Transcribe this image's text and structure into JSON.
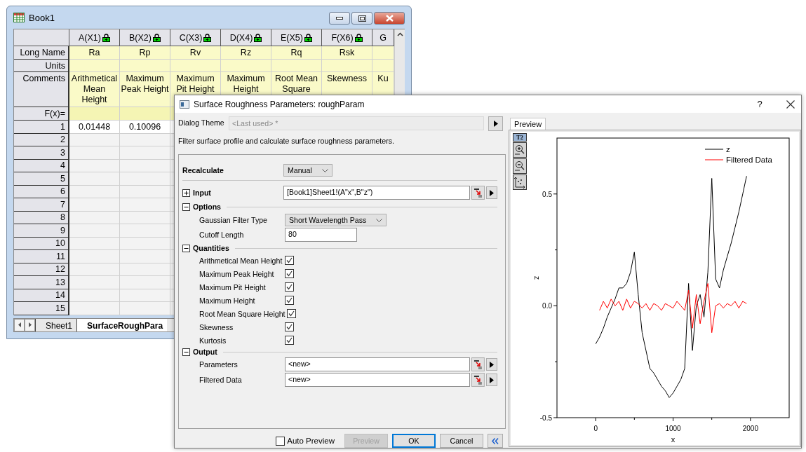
{
  "book": {
    "title": "Book1",
    "row_labels": [
      "Long Name",
      "Units",
      "Comments",
      "F(x)="
    ],
    "columns": [
      {
        "label": "A(X1)",
        "locked": true,
        "long_name": "Ra",
        "comments": "Arithmetical Mean Height"
      },
      {
        "label": "B(X2)",
        "locked": true,
        "long_name": "Rp",
        "comments": "Maximum Peak Height"
      },
      {
        "label": "C(X3)",
        "locked": true,
        "long_name": "Rv",
        "comments": "Maximum Pit Height"
      },
      {
        "label": "D(X4)",
        "locked": true,
        "long_name": "Rz",
        "comments": "Maximum Height"
      },
      {
        "label": "E(X5)",
        "locked": true,
        "long_name": "Rq",
        "comments": "Root Mean Square"
      },
      {
        "label": "F(X6)",
        "locked": true,
        "long_name": "Rsk",
        "comments": "Skewness"
      },
      {
        "label": "G",
        "locked": false,
        "comments": "Ku"
      }
    ],
    "rows": [
      {
        "label": "1",
        "cells": [
          "0.01448",
          "0.10096"
        ]
      },
      {
        "label": "2"
      },
      {
        "label": "3"
      },
      {
        "label": "4"
      },
      {
        "label": "5"
      },
      {
        "label": "6"
      },
      {
        "label": "7"
      },
      {
        "label": "8"
      },
      {
        "label": "9"
      },
      {
        "label": "10"
      },
      {
        "label": "11"
      },
      {
        "label": "12"
      },
      {
        "label": "13"
      },
      {
        "label": "14"
      },
      {
        "label": "15"
      }
    ],
    "sheet_tabs": [
      {
        "label": "Sheet1",
        "selected": false
      },
      {
        "label": "SurfaceRoughPara",
        "selected": true
      }
    ]
  },
  "dialog": {
    "title": "Surface Roughness Parameters: roughParam",
    "help": "?",
    "theme": {
      "label": "Dialog Theme",
      "placeholder": "<Last used> *",
      "disabled": true
    },
    "description": "Filter surface profile and calculate surface roughness parameters.",
    "form": [
      {
        "kind": "dropdown",
        "label": "Recalculate",
        "value": "Manual"
      },
      {
        "kind": "data",
        "label": "Input",
        "expanded": false,
        "value": "[Book1]Sheet1!(A\"x\",B\"z\")"
      },
      {
        "kind": "group",
        "label": "Options",
        "expanded": true,
        "children": [
          {
            "kind": "dropdown",
            "label": "Gaussian Filter Type",
            "value": "Short Wavelength Pass"
          },
          {
            "kind": "text",
            "label": "Cutoff Length",
            "value": "80"
          }
        ]
      },
      {
        "kind": "group",
        "label": "Quantities",
        "expanded": true,
        "children": [
          {
            "kind": "checkbox",
            "label": "Arithmetical Mean Height",
            "checked": true
          },
          {
            "kind": "checkbox",
            "label": "Maximum Peak Height",
            "checked": true
          },
          {
            "kind": "checkbox",
            "label": "Maximum Pit Height",
            "checked": true
          },
          {
            "kind": "checkbox",
            "label": "Maximum Height",
            "checked": true
          },
          {
            "kind": "checkbox",
            "label": "Root Mean Square Height",
            "checked": true
          },
          {
            "kind": "checkbox",
            "label": "Skewness",
            "checked": true
          },
          {
            "kind": "checkbox",
            "label": "Kurtosis",
            "checked": true
          }
        ]
      },
      {
        "kind": "group",
        "label": "Output",
        "expanded": true,
        "children": [
          {
            "kind": "data",
            "label": "Parameters",
            "value": "<new>"
          },
          {
            "kind": "data",
            "label": "Filtered Data",
            "value": "<new>"
          }
        ]
      }
    ],
    "auto_preview": {
      "label": "Auto Preview",
      "checked": false
    },
    "buttons": [
      {
        "label": "Preview",
        "disabled": true,
        "default": false
      },
      {
        "label": "OK",
        "disabled": false,
        "default": true
      },
      {
        "label": "Cancel",
        "disabled": false,
        "default": false
      }
    ],
    "preview": {
      "tab": {
        "label": "Preview",
        "selected": true
      },
      "toolbar_label": "T2",
      "chart_data": {
        "type": "line",
        "xlabel": "x",
        "ylabel": "z",
        "x": [
          0,
          50,
          100,
          150,
          200,
          250,
          300,
          350,
          400,
          450,
          500,
          550,
          600,
          650,
          700,
          750,
          800,
          850,
          900,
          950,
          1000,
          1050,
          1100,
          1150,
          1200,
          1250,
          1300,
          1350,
          1400,
          1450,
          1500,
          1550,
          1600,
          1650,
          1700,
          1750,
          1800,
          1850,
          1900,
          1950
        ],
        "series": [
          {
            "name": "z",
            "color": "#000000",
            "values": [
              -0.17,
              -0.14,
              -0.1,
              -0.05,
              -0.01,
              0.03,
              0.08,
              0.08,
              0.1,
              0.15,
              0.24,
              0.05,
              -0.12,
              -0.2,
              -0.28,
              -0.3,
              -0.33,
              -0.36,
              -0.38,
              -0.41,
              -0.39,
              -0.36,
              -0.33,
              -0.28,
              0.1,
              -0.2,
              0.0,
              0.05,
              -0.05,
              0.15,
              0.57,
              0.12,
              0.08,
              0.16,
              0.22,
              0.28,
              0.35,
              0.42,
              0.5,
              0.58
            ]
          },
          {
            "name": "Filtered Data",
            "color": "#ff0000",
            "values": [
              null,
              -0.02,
              0.02,
              -0.01,
              0.03,
              0.0,
              0.02,
              -0.02,
              0.03,
              -0.01,
              0.02,
              0.01,
              -0.01,
              0.01,
              -0.02,
              0.01,
              0.0,
              -0.02,
              0.01,
              0.0,
              -0.01,
              0.02,
              0.0,
              -0.02,
              0.07,
              -0.1,
              0.05,
              -0.08,
              0.02,
              0.1,
              -0.12,
              0.0,
              0.01,
              -0.01,
              0.01,
              0.0,
              0.02,
              -0.01,
              0.02,
              0.01
            ]
          }
        ],
        "legend": "upper right",
        "xlim": [
          -500,
          2500
        ],
        "ylim": [
          -0.5,
          0.75
        ],
        "xticks": [
          0,
          1000,
          2000
        ],
        "yticks": [
          {
            "value": -0.5,
            "label": "-0.5"
          },
          {
            "value": 0,
            "label": "0.0"
          },
          {
            "value": 0.5,
            "label": "0.5"
          }
        ]
      }
    }
  }
}
